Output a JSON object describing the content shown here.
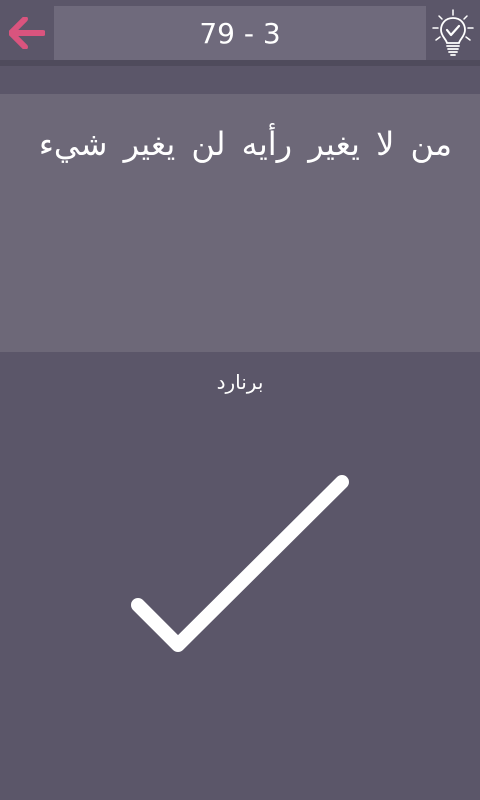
{
  "header": {
    "level": "79 - 3",
    "back_icon": "arrow-left-icon",
    "hint_icon": "lightbulb-icon",
    "back_color": "#d9547e"
  },
  "quote": {
    "text": "من لا يغير رأيه لن يغير شيء"
  },
  "author": {
    "name": "برنارد"
  },
  "result": {
    "icon": "checkmark-icon",
    "state": "correct"
  },
  "colors": {
    "background": "#5b5669",
    "panel": "#6d6878",
    "level_box": "#6f6a7c"
  }
}
